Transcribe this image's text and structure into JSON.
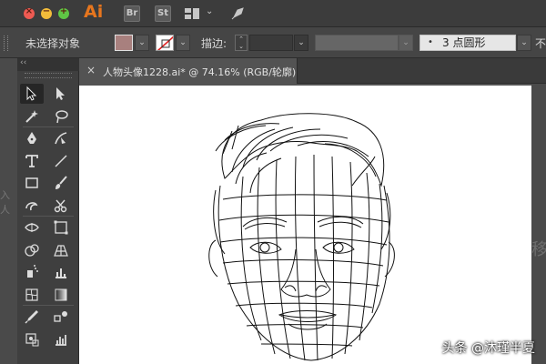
{
  "app": {
    "logo": "Ai",
    "bridge_label": "Br",
    "stock_label": "St"
  },
  "control_bar": {
    "selection_status": "未选择对象",
    "stroke_label": "描边:",
    "brush_label": "3 点圆形",
    "brush_dot": "•",
    "overflow_label": "不"
  },
  "document": {
    "tab_title": "人物头像1228.ai* @ 74.16% (RGB/轮廓)",
    "close_glyph": "×"
  },
  "toolbox": {
    "collapse_glyph": "‹‹"
  },
  "watermark": {
    "text": "头条 @沐瑾半夏"
  },
  "ghosts": {
    "left_text": "入人",
    "right_text": "移"
  },
  "colors": {
    "fill": "#a8807e",
    "accent_logo": "#e7761e",
    "canvas_bg": "#535353",
    "artboard": "#ffffff"
  },
  "tools": [
    "selection-tool",
    "direct-selection-tool",
    "magic-wand-tool",
    "lasso-tool",
    "pen-tool",
    "curvature-tool",
    "type-tool",
    "line-segment-tool",
    "rectangle-tool",
    "paintbrush-tool",
    "shaper-tool",
    "scissors-tool",
    "width-tool",
    "free-transform-tool",
    "shape-builder-tool",
    "perspective-grid-tool",
    "symbol-sprayer-tool",
    "graph-tool",
    "mesh-tool",
    "gradient-tool",
    "eyedropper-tool",
    "blend-tool",
    "symbol-tool",
    "column-graph-tool"
  ]
}
